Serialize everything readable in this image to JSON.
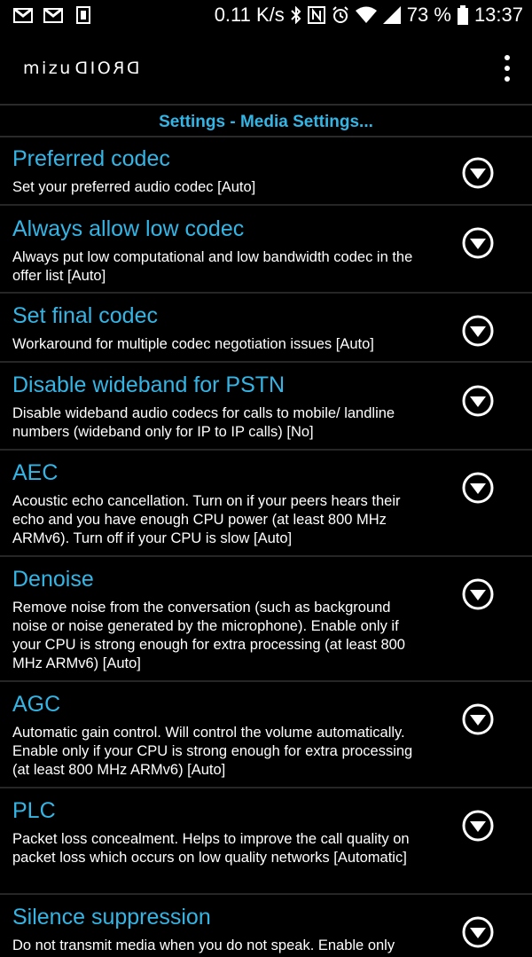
{
  "status_bar": {
    "left_icons": [
      "gmail-icon",
      "gmail-icon",
      "app-notification-icon"
    ],
    "network_speed": "0.11 K/s",
    "battery_percent": "73 %",
    "time": "13:37"
  },
  "app_bar": {
    "logo_left": "mizu",
    "logo_right": "DROID"
  },
  "section_header": "Settings - Media Settings...",
  "settings": [
    {
      "title": "Preferred codec",
      "summary": "Set your preferred audio codec [Auto]"
    },
    {
      "title": "Always allow low codec",
      "summary": "Always put low computational and low bandwidth codec in the offer list [Auto]"
    },
    {
      "title": "Set final codec",
      "summary": "Workaround for multiple codec negotiation issues [Auto]"
    },
    {
      "title": "Disable wideband for PSTN",
      "summary": "Disable wideband audio codecs for calls to mobile/ landline numbers (wideband only for IP to IP calls) [No]"
    },
    {
      "title": "AEC",
      "summary": "Acoustic echo cancellation. Turn on if your peers hears their echo and you have enough CPU power (at least 800 MHz ARMv6). Turn off if your CPU is slow [Auto]"
    },
    {
      "title": "Denoise",
      "summary": "Remove noise from the conversation (such as background noise or noise generated by the microphone). Enable only if your CPU is strong enough for extra processing (at least 800 MHz ARMv6) [Auto]"
    },
    {
      "title": "AGC",
      "summary": "Automatic gain control. Will control the volume automatically. Enable only if your CPU is strong enough for extra processing (at least 800 MHz ARMv6) [Auto]"
    },
    {
      "title": "PLC",
      "summary": "Packet loss concealment. Helps to improve the call quality on packet loss which occurs on low quality networks [Automatic]"
    },
    {
      "title": "Silence suppression",
      "summary": "Do not transmit media when you do not speak. Enable only"
    }
  ],
  "colors": {
    "accent": "#33b5e5",
    "background": "#000000",
    "divider": "#262626"
  }
}
